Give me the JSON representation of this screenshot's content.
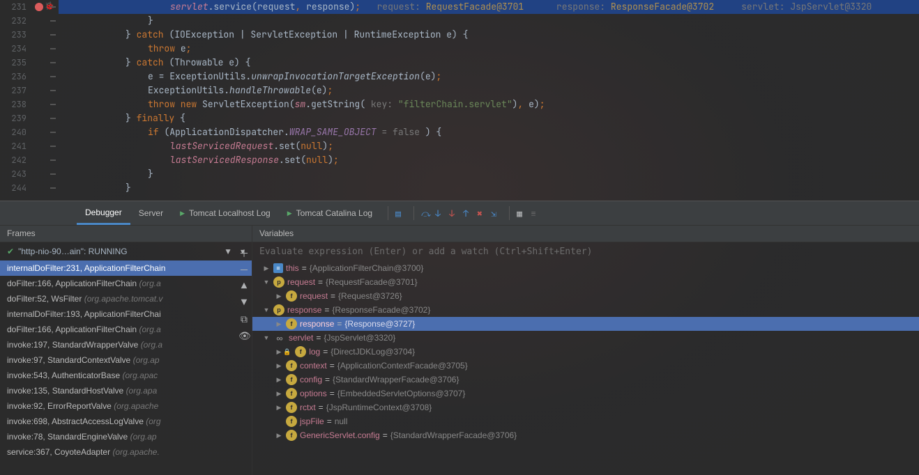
{
  "editor": {
    "lines": [
      {
        "num": 231,
        "bp": true,
        "hl": true,
        "indent": 20,
        "tokens": [
          [
            "fld",
            "servlet"
          ],
          [
            "id",
            "."
          ],
          [
            "id",
            "service"
          ],
          [
            "id",
            "("
          ],
          [
            "par",
            "request"
          ],
          [
            "p",
            ", "
          ],
          [
            "par",
            "response"
          ],
          [
            "id",
            ")"
          ],
          [
            "p",
            ";"
          ],
          [
            "hint",
            "   request: "
          ],
          [
            "hintv",
            "RequestFacade@3701"
          ],
          [
            "hint",
            "      response: "
          ],
          [
            "hintv",
            "ResponseFacade@3702"
          ],
          [
            "hint",
            "     servlet: JspServlet@3320"
          ]
        ]
      },
      {
        "num": 232,
        "indent": 16,
        "tokens": [
          [
            "id",
            "}"
          ]
        ]
      },
      {
        "num": 233,
        "indent": 12,
        "tokens": [
          [
            "id",
            "} "
          ],
          [
            "kw",
            "catch "
          ],
          [
            "id",
            "(IOException | ServletException | RuntimeException e) {"
          ]
        ]
      },
      {
        "num": 234,
        "indent": 16,
        "tokens": [
          [
            "kw",
            "throw "
          ],
          [
            "id",
            "e"
          ],
          [
            "p",
            ";"
          ]
        ]
      },
      {
        "num": 235,
        "indent": 12,
        "tokens": [
          [
            "id",
            "} "
          ],
          [
            "kw",
            "catch "
          ],
          [
            "id",
            "(Throwable "
          ],
          [
            "par",
            "e"
          ],
          [
            "id",
            ") {"
          ]
        ]
      },
      {
        "num": 236,
        "indent": 16,
        "tokens": [
          [
            "par",
            "e"
          ],
          [
            "id",
            " = ExceptionUtils."
          ],
          [
            "mth",
            "unwrapInvocationTargetException"
          ],
          [
            "id",
            "("
          ],
          [
            "par",
            "e"
          ],
          [
            "id",
            ")"
          ],
          [
            "p",
            ";"
          ]
        ]
      },
      {
        "num": 237,
        "indent": 16,
        "tokens": [
          [
            "id",
            "ExceptionUtils."
          ],
          [
            "mth",
            "handleThrowable"
          ],
          [
            "id",
            "("
          ],
          [
            "par",
            "e"
          ],
          [
            "id",
            ")"
          ],
          [
            "p",
            ";"
          ]
        ]
      },
      {
        "num": 238,
        "indent": 16,
        "tokens": [
          [
            "kw",
            "throw new "
          ],
          [
            "id",
            "ServletException("
          ],
          [
            "fld",
            "sm"
          ],
          [
            "id",
            ".getString( "
          ],
          [
            "hint",
            "key: "
          ],
          [
            "str",
            "\"filterChain.servlet\""
          ],
          [
            "id",
            ")"
          ],
          [
            "p",
            ", "
          ],
          [
            "par",
            "e"
          ],
          [
            "id",
            ")"
          ],
          [
            "p",
            ";"
          ]
        ]
      },
      {
        "num": 239,
        "indent": 12,
        "tokens": [
          [
            "id",
            "} "
          ],
          [
            "kw",
            "finally "
          ],
          [
            "id",
            "{"
          ]
        ]
      },
      {
        "num": 240,
        "indent": 16,
        "tokens": [
          [
            "kw",
            "if "
          ],
          [
            "id",
            "(ApplicationDispatcher."
          ],
          [
            "fld2",
            "WRAP_SAME_OBJECT"
          ],
          [
            "hint",
            " = false "
          ],
          [
            "id",
            ") {"
          ]
        ]
      },
      {
        "num": 241,
        "indent": 20,
        "tokens": [
          [
            "fld",
            "lastServicedRequest"
          ],
          [
            "id",
            ".set("
          ],
          [
            "kw",
            "null"
          ],
          [
            "id",
            ")"
          ],
          [
            "p",
            ";"
          ]
        ]
      },
      {
        "num": 242,
        "indent": 20,
        "tokens": [
          [
            "fld",
            "lastServicedResponse"
          ],
          [
            "id",
            ".set("
          ],
          [
            "kw",
            "null"
          ],
          [
            "id",
            ")"
          ],
          [
            "p",
            ";"
          ]
        ]
      },
      {
        "num": 243,
        "indent": 16,
        "tokens": [
          [
            "id",
            "}"
          ]
        ]
      },
      {
        "num": 244,
        "indent": 12,
        "tokens": [
          [
            "id",
            "}"
          ]
        ]
      }
    ]
  },
  "debug": {
    "tabs": [
      {
        "label": "Debugger",
        "active": true
      },
      {
        "label": "Server"
      },
      {
        "label": "Tomcat Localhost Log",
        "icon": "play"
      },
      {
        "label": "Tomcat Catalina Log",
        "icon": "play"
      }
    ],
    "frames_title": "Frames",
    "thread": {
      "name": "\"http-nio-90…ain\": RUNNING"
    },
    "frames": [
      {
        "m": "internalDoFilter:231, ApplicationFilterChain",
        "sel": true
      },
      {
        "m": "doFilter:166, ApplicationFilterChain",
        "p": "(org.a"
      },
      {
        "m": "doFilter:52, WsFilter",
        "p": "(org.apache.tomcat.v"
      },
      {
        "m": "internalDoFilter:193, ApplicationFilterChai"
      },
      {
        "m": "doFilter:166, ApplicationFilterChain",
        "p": "(org.a"
      },
      {
        "m": "invoke:197, StandardWrapperValve",
        "p": "(org.a"
      },
      {
        "m": "invoke:97, StandardContextValve",
        "p": "(org.ap"
      },
      {
        "m": "invoke:543, AuthenticatorBase",
        "p": "(org.apac"
      },
      {
        "m": "invoke:135, StandardHostValve",
        "p": "(org.apa"
      },
      {
        "m": "invoke:92, ErrorReportValve",
        "p": "(org.apache"
      },
      {
        "m": "invoke:698, AbstractAccessLogValve",
        "p": "(org"
      },
      {
        "m": "invoke:78, StandardEngineValve",
        "p": "(org.ap"
      },
      {
        "m": "service:367, CoyoteAdapter",
        "p": "(org.apache."
      }
    ],
    "vars_title": "Variables",
    "eval_placeholder": "Evaluate expression (Enter) or add a watch (Ctrl+Shift+Enter)",
    "vars": [
      {
        "d": 0,
        "exp": "closed",
        "ico": "t",
        "name": "this",
        "val": "{ApplicationFilterChain@3700}"
      },
      {
        "d": 0,
        "exp": "open",
        "ico": "p",
        "name": "request",
        "val": "{RequestFacade@3701}"
      },
      {
        "d": 1,
        "exp": "closed",
        "ico": "f",
        "name": "request",
        "val": "{Request@3726}"
      },
      {
        "d": 0,
        "exp": "open",
        "ico": "p",
        "name": "response",
        "val": "{ResponseFacade@3702}"
      },
      {
        "d": 1,
        "exp": "closed",
        "ico": "f",
        "name": "response",
        "val": "{Response@3727}",
        "sel": true
      },
      {
        "d": 0,
        "exp": "open",
        "ico": "oo",
        "name": "servlet",
        "val": "{JspServlet@3320}"
      },
      {
        "d": 1,
        "exp": "closed",
        "ico": "f",
        "lock": true,
        "name": "log",
        "val": "{DirectJDKLog@3704}"
      },
      {
        "d": 1,
        "exp": "closed",
        "ico": "f",
        "name": "context",
        "val": "{ApplicationContextFacade@3705}"
      },
      {
        "d": 1,
        "exp": "closed",
        "ico": "f",
        "name": "config",
        "val": "{StandardWrapperFacade@3706}"
      },
      {
        "d": 1,
        "exp": "closed",
        "ico": "f",
        "name": "options",
        "val": "{EmbeddedServletOptions@3707}"
      },
      {
        "d": 1,
        "exp": "closed",
        "ico": "f",
        "name": "rctxt",
        "val": "{JspRuntimeContext@3708}"
      },
      {
        "d": 1,
        "exp": "none",
        "ico": "f",
        "name": "jspFile",
        "val": "null"
      },
      {
        "d": 1,
        "exp": "closed",
        "ico": "f",
        "name": "GenericServlet.config",
        "val": "{StandardWrapperFacade@3706}"
      }
    ]
  }
}
